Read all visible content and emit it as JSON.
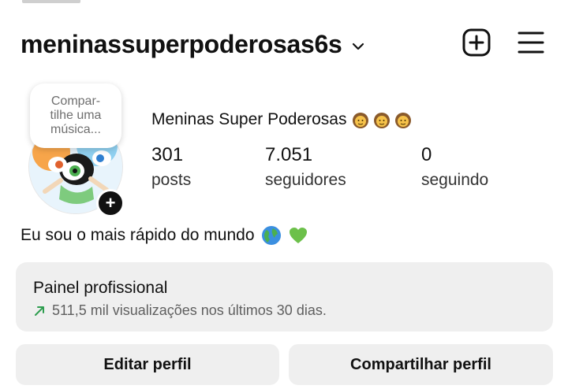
{
  "header": {
    "username": "meninassuperpoderosas6s",
    "icons": [
      "chevron-down-icon",
      "new-post-icon",
      "menu-icon"
    ]
  },
  "profile": {
    "note": "Compar-\ntilhe uma\nmúsica...",
    "display_name": "Meninas Super Poderosas",
    "name_emojis": [
      "girl-emoji",
      "girl-emoji",
      "girl-emoji"
    ],
    "add_badge": "+",
    "stats": [
      {
        "value": "301",
        "label": "posts"
      },
      {
        "value": "7.051",
        "label": "seguidores"
      },
      {
        "value": "0",
        "label": "seguindo"
      }
    ],
    "bio": "Eu sou o mais rápido do mundo",
    "bio_emojis": [
      "globe-emoji",
      "green-heart-emoji"
    ]
  },
  "panel": {
    "title": "Painel profissional",
    "subtitle": "511,5 mil visualizações nos últimos 30 dias.",
    "trend_icon": "trend-up-arrow-icon",
    "accent": "#2e9d4f"
  },
  "actions": {
    "edit_label": "Editar perfil",
    "share_label": "Compartilhar perfil"
  }
}
